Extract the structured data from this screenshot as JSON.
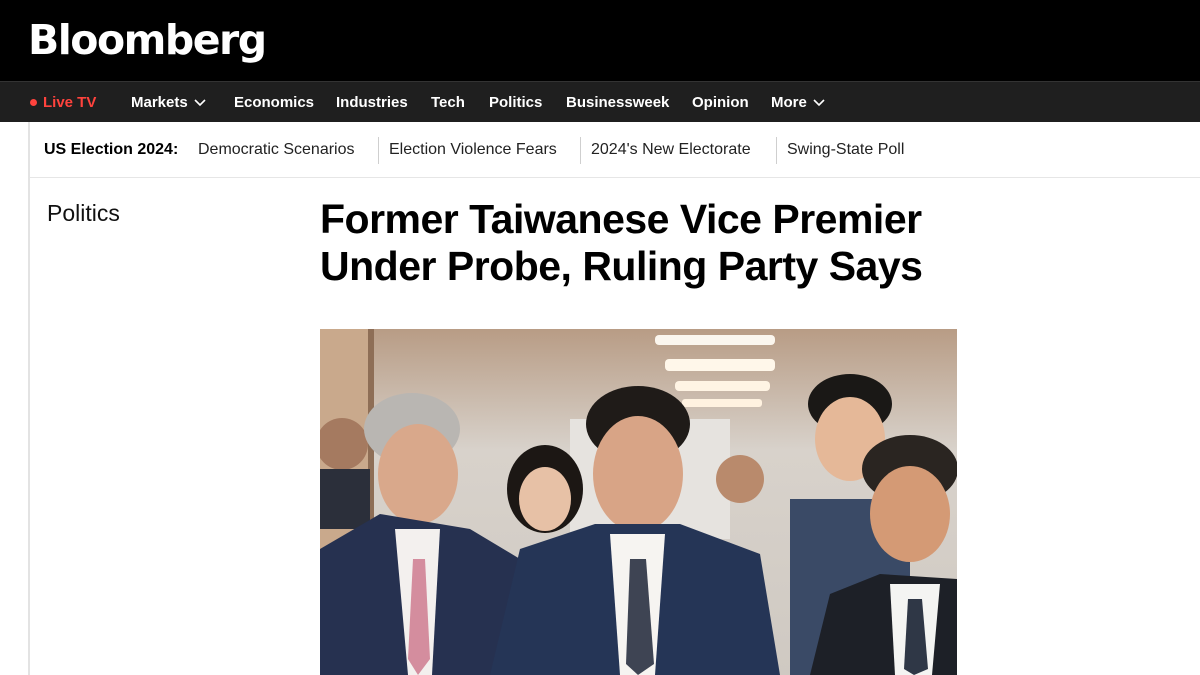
{
  "header": {
    "logo": "Bloomberg"
  },
  "nav": {
    "live_tv": "Live TV",
    "items": [
      "Markets",
      "Economics",
      "Industries",
      "Tech",
      "Politics",
      "Businessweek",
      "Opinion",
      "More"
    ]
  },
  "subnav": {
    "title": "US Election 2024:",
    "links": [
      "Democratic Scenarios",
      "Election Violence Fears",
      "2024's New Electorate",
      "Swing-State Poll"
    ]
  },
  "article": {
    "section": "Politics",
    "headline_line1": "Former Taiwanese Vice Premier",
    "headline_line2": "Under Probe, Ruling Party Says"
  },
  "colors": {
    "live_red": "#ff433d",
    "topbar_bg": "#000000",
    "navbar_bg": "#1f1f1f"
  }
}
